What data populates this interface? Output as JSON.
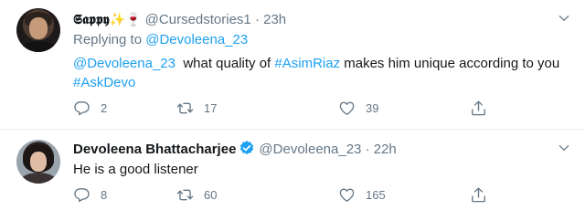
{
  "tweets": [
    {
      "name": "𝕾𝖆𝖕𝖕𝖞",
      "name_emoji": "✨🍷",
      "handle": "@Cursedstories1",
      "separator": "·",
      "time": "23h",
      "replying_prefix": "Replying to",
      "replying_to": "@Devoleena_23",
      "body": {
        "mention": "@Devoleena_23",
        "text1": "  what quality of ",
        "hashtag1": "#AsimRiaz",
        "text2": " makes him unique according to you ",
        "hashtag2": "#AskDevo"
      },
      "actions": {
        "replies": "2",
        "retweets": "17",
        "likes": "39"
      }
    },
    {
      "name": "Devoleena Bhattacharjee",
      "handle": "@Devoleena_23",
      "separator": "·",
      "time": "22h",
      "body": {
        "text": "He is a good listener"
      },
      "actions": {
        "replies": "8",
        "retweets": "60",
        "likes": "165"
      }
    }
  ],
  "icons": {
    "reply": "reply-icon",
    "retweet": "retweet-icon",
    "like": "heart-icon",
    "share": "share-icon",
    "verified": "verified-badge-icon",
    "more": "chevron-down-icon"
  },
  "colors": {
    "link": "#1da1f2",
    "muted": "#657786",
    "verified": "#1da1f2"
  }
}
